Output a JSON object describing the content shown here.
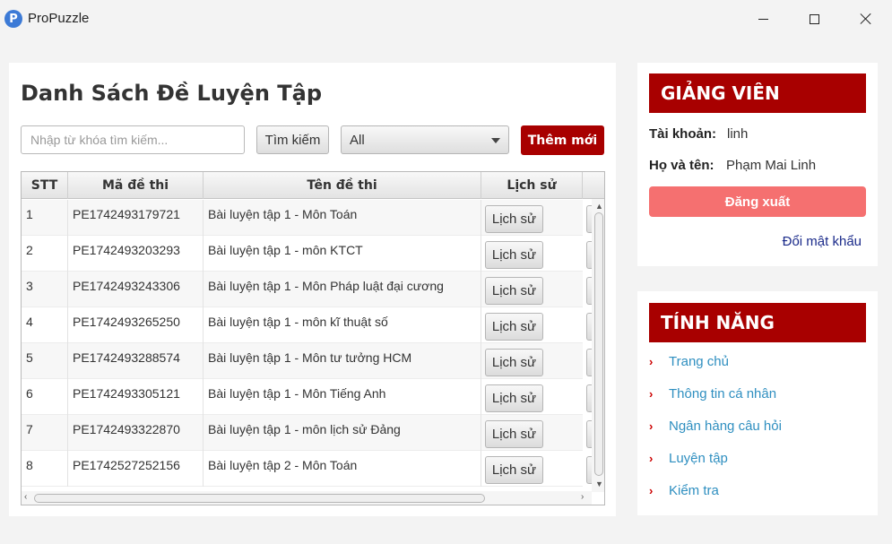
{
  "window": {
    "title": "ProPuzzle",
    "app_icon_letter": "P"
  },
  "main": {
    "title": "Danh Sách Đề Luyện Tập",
    "search_placeholder": "Nhập từ khóa tìm kiếm...",
    "search_button": "Tìm kiếm",
    "filter_selected": "All",
    "add_button": "Thêm mới"
  },
  "table": {
    "columns": [
      "STT",
      "Mã đề thi",
      "Tên đề thi",
      "Lịch sử"
    ],
    "rows": [
      {
        "stt": "1",
        "code": "PE1742493179721",
        "name": "Bài luyện tập 1 - Môn Toán",
        "action": "Lịch sử"
      },
      {
        "stt": "2",
        "code": "PE1742493203293",
        "name": "Bài luyện tập 1 - môn KTCT",
        "action": "Lịch sử"
      },
      {
        "stt": "3",
        "code": "PE1742493243306",
        "name": "Bài luyện tập 1 - Môn Pháp luật đại cương",
        "action": "Lịch sử"
      },
      {
        "stt": "4",
        "code": "PE1742493265250",
        "name": "Bài luyện tập 1 - môn kĩ thuật số",
        "action": "Lịch sử"
      },
      {
        "stt": "5",
        "code": "PE1742493288574",
        "name": "Bài luyện tập 1 - Môn tư tưởng HCM",
        "action": "Lịch sử"
      },
      {
        "stt": "6",
        "code": "PE1742493305121",
        "name": "Bài luyện tập 1 - Môn Tiếng Anh",
        "action": "Lịch sử"
      },
      {
        "stt": "7",
        "code": "PE1742493322870",
        "name": "Bài luyện tập 1 - môn lịch sử Đảng",
        "action": "Lịch sử"
      },
      {
        "stt": "8",
        "code": "PE1742527252156",
        "name": "Bài luyện tập 2 - Môn Toán",
        "action": "Lịch sử"
      }
    ]
  },
  "lecturer": {
    "header": "GIẢNG VIÊN",
    "account_label": "Tài khoản:",
    "account_value": "linh",
    "name_label": "Họ và tên:",
    "name_value": "Phạm Mai Linh",
    "logout_button": "Đăng xuất",
    "change_password": "Đổi mật khẩu"
  },
  "features": {
    "header": "TÍNH NĂNG",
    "arrow": "›",
    "items": [
      "Trang chủ",
      "Thông tin cá nhân",
      "Ngân hàng câu hỏi",
      "Luyện tập",
      "Kiểm tra"
    ]
  },
  "colors": {
    "accent": "#a80000",
    "logout": "#f57070",
    "link": "#2f8fc0"
  }
}
